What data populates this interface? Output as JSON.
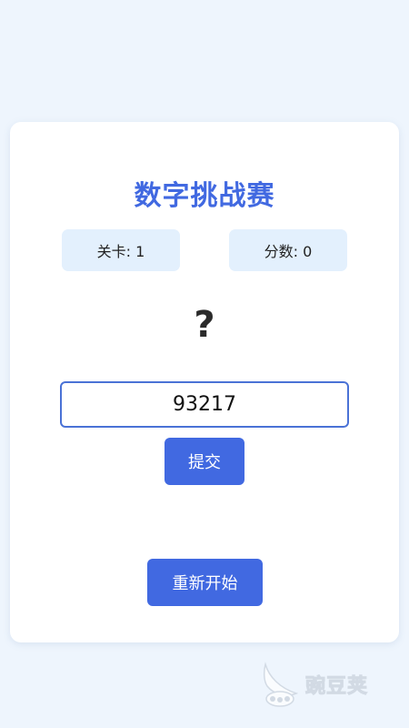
{
  "game": {
    "title": "数字挑战赛",
    "level_text": "关卡: 1",
    "score_text": "分数: 0",
    "mystery_symbol": "?",
    "answer_value": "93217",
    "submit_label": "提交",
    "restart_label": "重新开始"
  },
  "watermark": {
    "text": "豌豆荚",
    "icon": "pea-pod-logo"
  },
  "colors": {
    "accent": "#4169e1",
    "background": "#eef5fd",
    "stat_background": "#e3f0fd",
    "card": "#ffffff"
  }
}
